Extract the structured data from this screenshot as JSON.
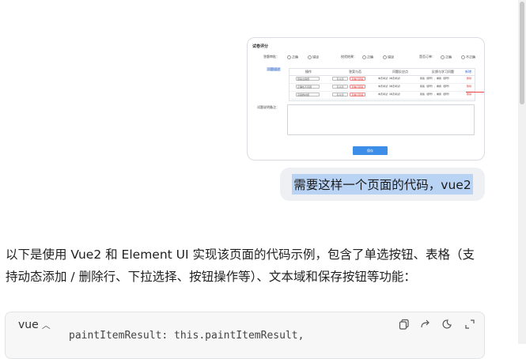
{
  "shot": {
    "title": "试卷评分",
    "row1": {
      "label": "答题审批：",
      "opt_a": "正确",
      "opt_b": "错误",
      "label2": "校验结果：",
      "opt_c": "正确",
      "opt_d": "错误",
      "label3": "是否订单：",
      "opt_e": "正确",
      "opt_f": "不正确"
    },
    "side_label": "问题描述",
    "table_headers": [
      "操作",
      "答案与否",
      "问题反应点",
      "反馈与学习问题",
      "新增"
    ],
    "rows": [
      {
        "select": "回答出错题",
        "btn1": "有关题",
        "btn2": "查看问题答",
        "text3": "本页考试（本页考试）",
        "text4": "我答（题号），看我（题号）",
        "del": "删除"
      },
      {
        "select": "正确性不足题",
        "btn1": "有关题",
        "btn2": "查看问题答",
        "text3": "本页考试（本页考试）",
        "text4": "我答（题号），看我（题号）",
        "del": "删除"
      },
      {
        "select": "高级教材题",
        "btn1": "有关题",
        "btn2": "查看问题答",
        "text3": "本页考试（本页考试）",
        "text4": "我答（题号），看我（题号）",
        "del": "删除"
      }
    ],
    "remark_label": "试题说明备注：",
    "save": "保存"
  },
  "bubble": {
    "text": "需要这样一个页面的代码，vue2"
  },
  "answer": {
    "text": "以下是使用 Vue2 和 Element UI 实现该页面的代码示例，包含了单选按钮、表格（支持动态添加 / 删除行、下拉选择、按钮操作等）、文本域和保存按钮等功能："
  },
  "code": {
    "lang": "vue",
    "line": "paintItemResult: this.paintItemResult,"
  },
  "icons": [
    "chevron-up-icon",
    "copy-icon",
    "share-icon",
    "run-icon",
    "expand-icon"
  ]
}
